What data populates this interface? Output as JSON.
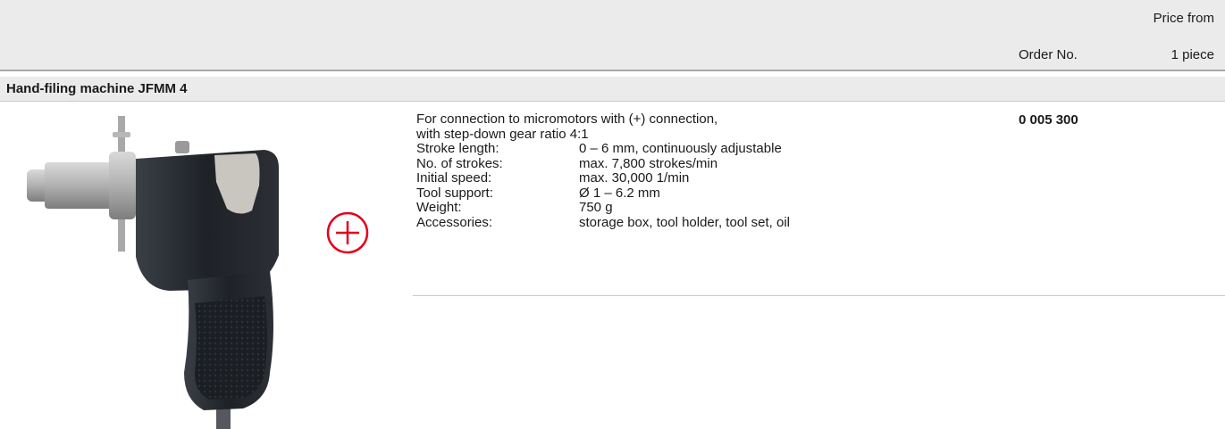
{
  "table_header": {
    "price_label_line1": "Price from",
    "order_no_label": "Order No.",
    "price_label_line2": "1 piece"
  },
  "section": {
    "title": "Hand-filing machine JFMM 4"
  },
  "product": {
    "description_line1": "For connection to micromotors with (+) connection,",
    "description_line2": "with step-down gear ratio 4:1",
    "specs": [
      {
        "label": "Stroke length:",
        "value": "0 – 6 mm, continuously adjustable"
      },
      {
        "label": "No. of strokes:",
        "value": "max. 7,800 strokes/min"
      },
      {
        "label": "Initial speed:",
        "value": "max. 30,000 1/min"
      },
      {
        "label": "Tool support:",
        "value": "Ø 1 – 6.2 mm"
      },
      {
        "label": "Weight:",
        "value": "750 g"
      },
      {
        "label": "Accessories:",
        "value": "storage box, tool holder, tool set, oil"
      }
    ],
    "order_no": "0 005 300",
    "image_icon": "hand-filing-machine-photo",
    "connection_icon": "plus-connection-icon",
    "connection_icon_color": "#e3001b"
  }
}
